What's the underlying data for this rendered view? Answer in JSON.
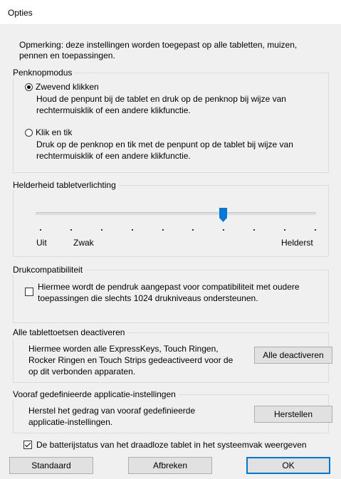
{
  "window": {
    "title": "Opties"
  },
  "note": "Opmerking: deze instellingen worden toegepast op alle tabletten, muizen, pennen en toepassingen.",
  "pen_button_mode": {
    "legend": "Penknopmodus",
    "options": [
      {
        "label": "Zwevend klikken",
        "selected": true,
        "description": "Houd de penpunt bij de tablet en druk op de penknop bij wijze van rechtermuisklik of een andere klikfunctie."
      },
      {
        "label": "Klik en tik",
        "selected": false,
        "description": "Druk op de penknop en tik met de penpunt op de tablet bij wijze van rechtermuisklik of een andere klikfunctie."
      }
    ]
  },
  "backlight": {
    "legend": "Helderheid tabletverlichting",
    "tick_count": 10,
    "selected_tick_index": 6,
    "labels": {
      "off": "Uit",
      "weak": "Zwak",
      "brightest": "Helderst"
    },
    "thumb_color": "#0078d7"
  },
  "pressure": {
    "legend": "Drukcompatibiliteit",
    "checked": false,
    "label": "Hiermee wordt de pendruk aangepast voor compatibiliteit met oudere toepassingen die slechts 1024 drukniveaus ondersteunen."
  },
  "disable_keys": {
    "legend": "Alle tablettoetsen deactiveren",
    "description": "Hiermee worden alle ExpressKeys, Touch Ringen, Rocker Ringen en Touch Strips gedeactiveerd voor de op dit verbonden apparaten.",
    "button": "Alle deactiveren"
  },
  "predefined": {
    "legend": "Vooraf gedefinieerde applicatie-instellingen",
    "description": "Herstel het gedrag van vooraf gedefinieerde applicatie-instellingen.",
    "button": "Herstellen"
  },
  "battery_status": {
    "checked": true,
    "label": "De batterijstatus van het draadloze tablet in het systeemvak weergeven"
  },
  "buttons": {
    "default": "Standaard",
    "cancel": "Afbreken",
    "ok": "OK"
  },
  "colors": {
    "accent": "#0078d7",
    "dialog_bg": "#f0f0f0"
  }
}
